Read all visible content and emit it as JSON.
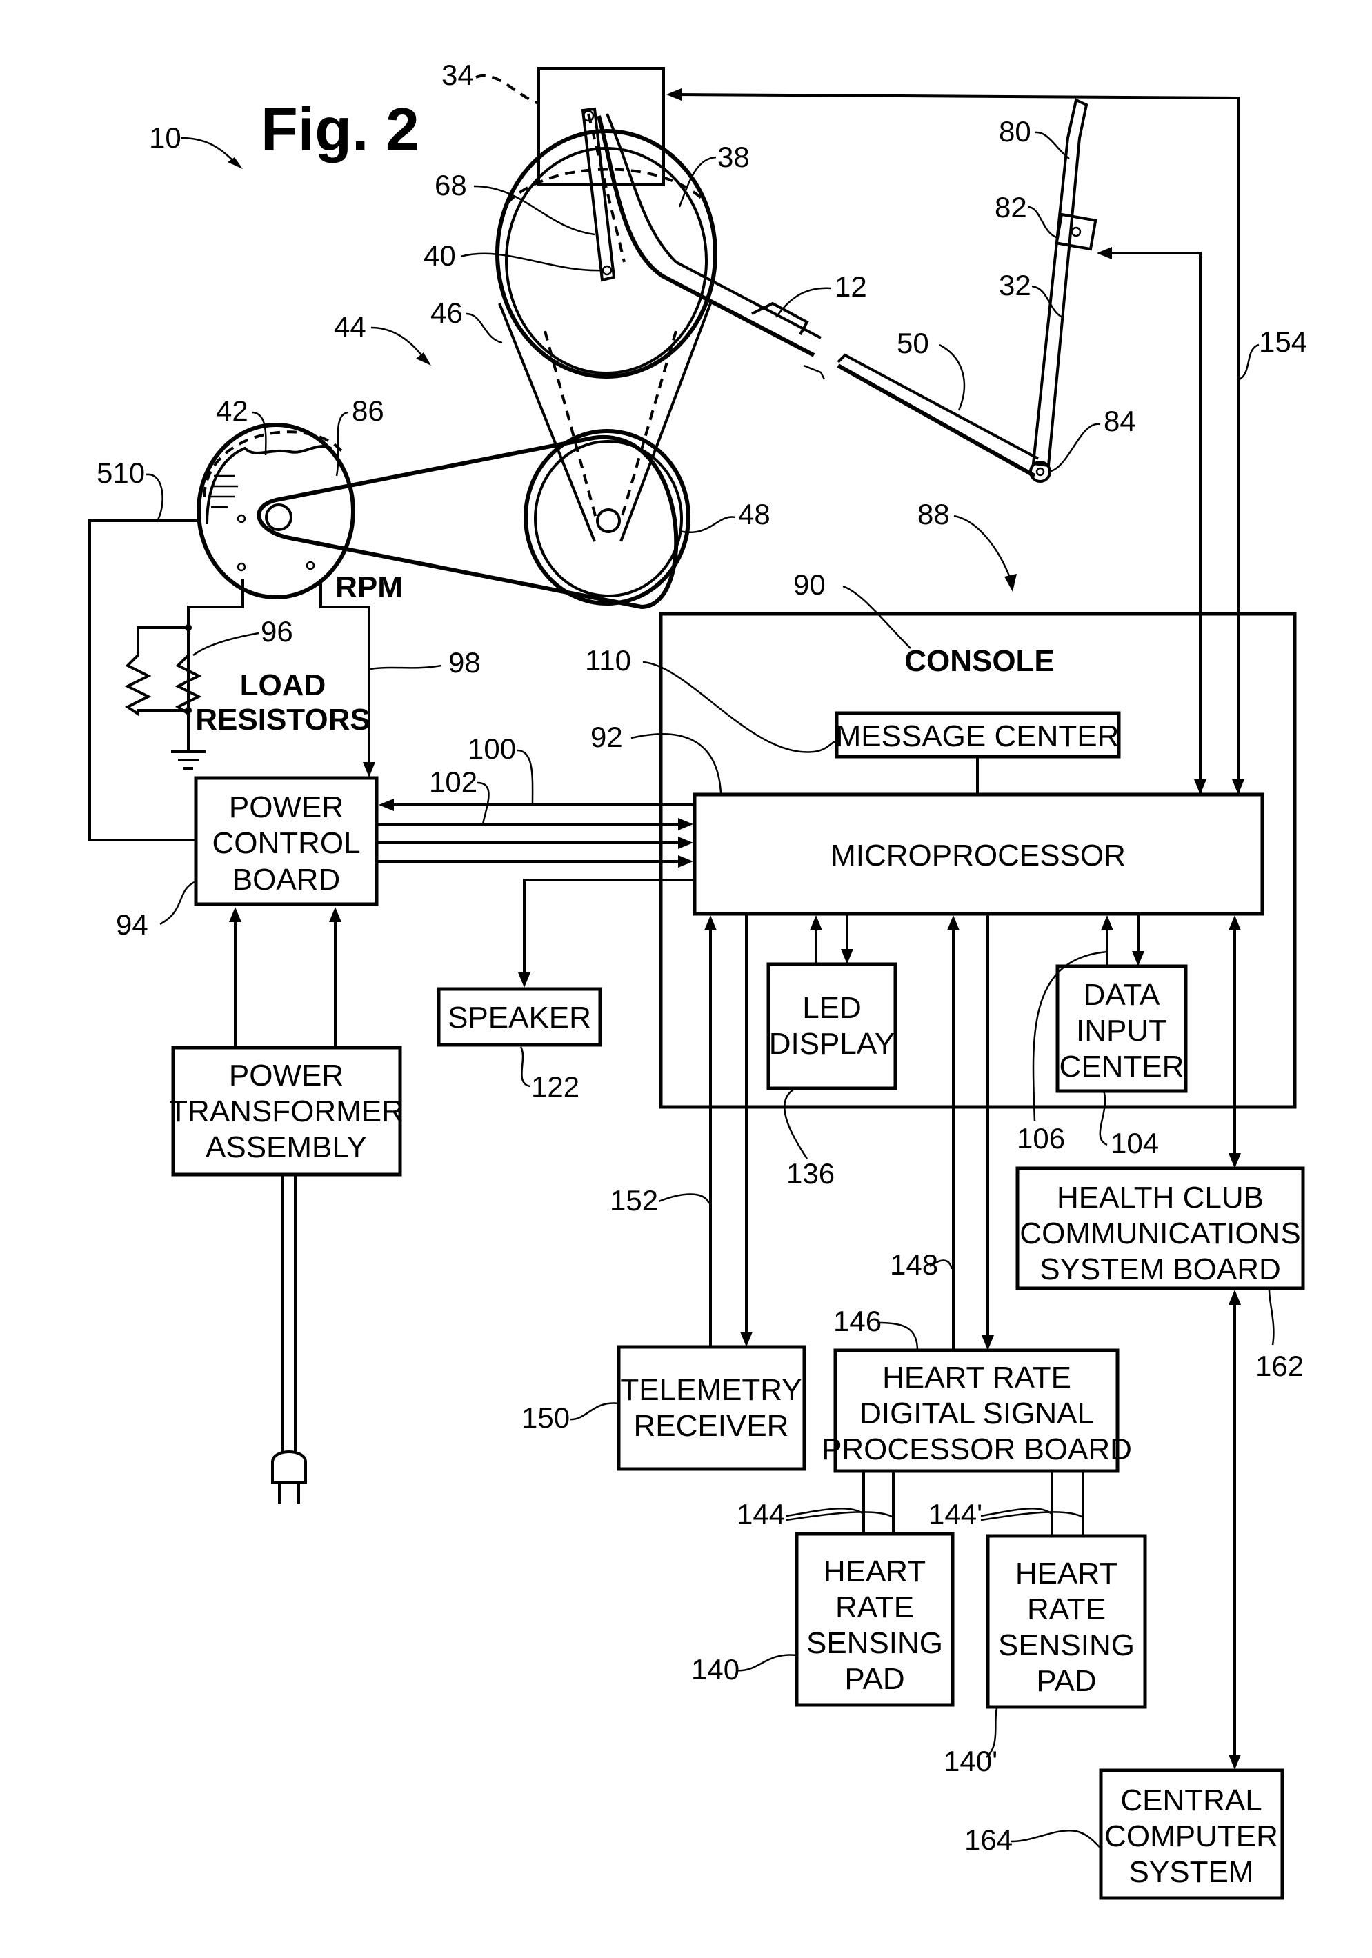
{
  "figure": {
    "title": "Fig. 2",
    "overall_ref": "10"
  },
  "mechanical_refs": {
    "controller_housing": "34",
    "crank_arm": "68",
    "crank_pivot": "40",
    "drive_wheel": "38",
    "drive_assembly": "44",
    "belt": "46",
    "idler_wheel": "48",
    "generator": "42",
    "generator_pulley": "86",
    "handle_top": "80",
    "handle_sensor": "82",
    "handle_arm": "32",
    "foot_link": "50",
    "foot_pad": "12",
    "handle_pivot": "84",
    "generator_wire": "510",
    "control_system": "88"
  },
  "labels": {
    "rpm": "RPM",
    "load_resistors_line1": "LOAD",
    "load_resistors_line2": "RESISTORS",
    "console": "CONSOLE"
  },
  "blocks": {
    "message_center": {
      "text": [
        "MESSAGE CENTER"
      ],
      "ref": "110"
    },
    "microprocessor": {
      "text": [
        "MICROPROCESSOR"
      ],
      "ref": "92"
    },
    "power_control_board": {
      "text": [
        "POWER",
        "CONTROL",
        "BOARD"
      ],
      "ref": "94"
    },
    "power_transformer": {
      "text": [
        "POWER",
        "TRANSFORMER",
        "ASSEMBLY"
      ]
    },
    "speaker": {
      "text": [
        "SPEAKER"
      ],
      "ref": "122"
    },
    "led_display": {
      "text": [
        "LED",
        "DISPLAY"
      ],
      "ref": "136"
    },
    "data_input_center": {
      "text": [
        "DATA",
        "INPUT",
        "CENTER"
      ],
      "ref": "104"
    },
    "health_club": {
      "text": [
        "HEALTH CLUB",
        "COMMUNICATIONS",
        "SYSTEM BOARD"
      ],
      "ref": "162"
    },
    "telemetry_receiver": {
      "text": [
        "TELEMETRY",
        "RECEIVER"
      ],
      "ref": "150"
    },
    "hr_dsp_board": {
      "text": [
        "HEART RATE",
        "DIGITAL SIGNAL",
        "PROCESSOR BOARD"
      ],
      "ref": "146"
    },
    "hr_pad_1": {
      "text": [
        "HEART",
        "RATE",
        "SENSING",
        "PAD"
      ],
      "ref": "140"
    },
    "hr_pad_2": {
      "text": [
        "HEART",
        "RATE",
        "SENSING",
        "PAD"
      ],
      "ref": "140'"
    },
    "central_computer": {
      "text": [
        "CENTRAL",
        "COMPUTER",
        "SYSTEM"
      ],
      "ref": "164"
    }
  },
  "wire_refs": {
    "console_box": "90",
    "resistor": "96",
    "rpm_line": "98",
    "control_bus": "100",
    "data_bus": "102",
    "data_input_line": "106",
    "telemetry_line": "152",
    "hr_line": "148",
    "hr_leads_1": "144",
    "hr_leads_2": "144'",
    "handle_line": "154"
  }
}
